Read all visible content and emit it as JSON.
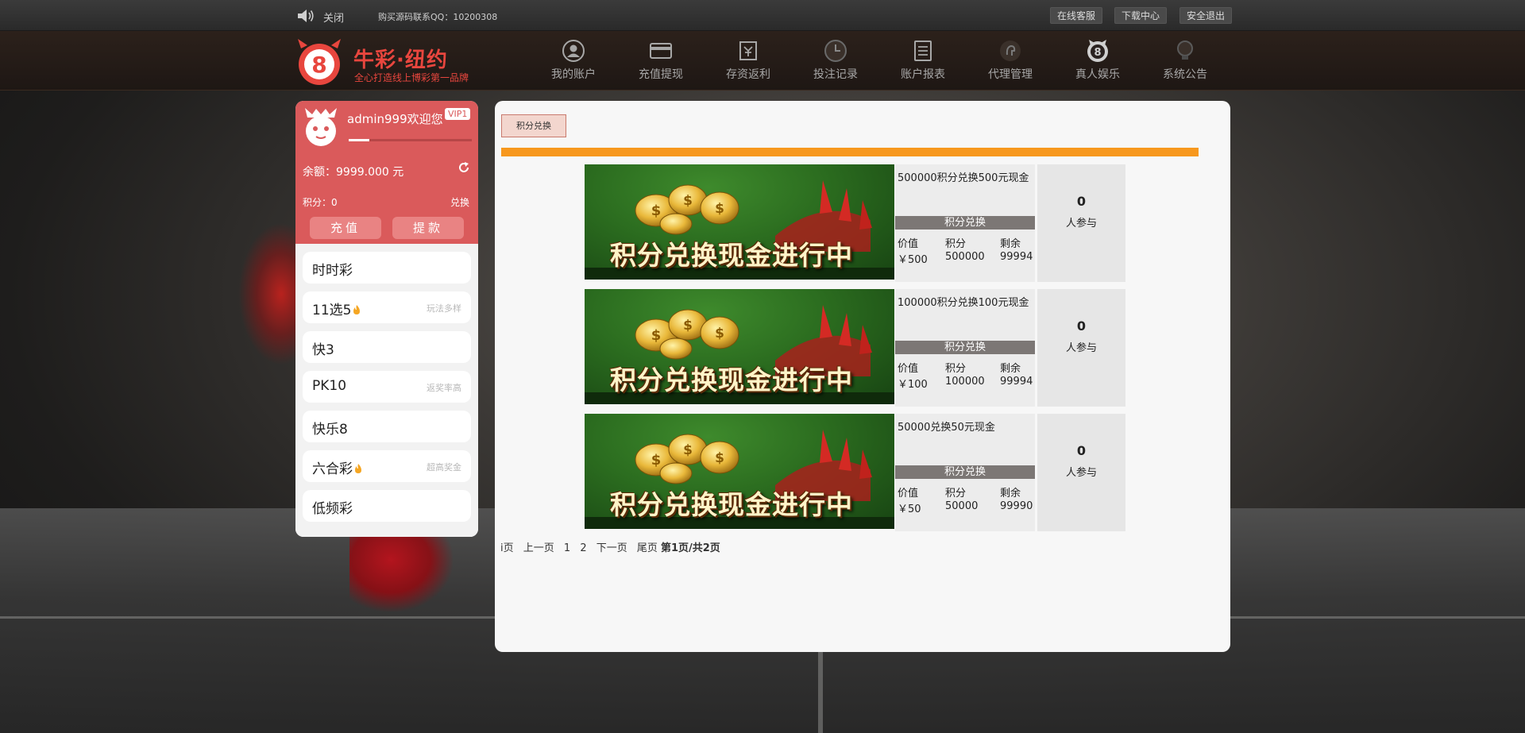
{
  "topbar": {
    "close_label": "关闭",
    "qq_text": "购买源码联系QQ：10200308",
    "buttons": [
      "在线客服",
      "下载中心",
      "安全退出"
    ]
  },
  "header": {
    "logo_title": "牛彩·纽约",
    "logo_sub": "全心打造线上博彩第一品牌",
    "nav": [
      {
        "label": "我的账户",
        "icon": "user-icon"
      },
      {
        "label": "充值提现",
        "icon": "card-icon"
      },
      {
        "label": "存资返利",
        "icon": "rebate-icon"
      },
      {
        "label": "投注记录",
        "icon": "clock-icon"
      },
      {
        "label": "账户报表",
        "icon": "report-icon"
      },
      {
        "label": "代理管理",
        "icon": "agent-icon"
      },
      {
        "label": "真人娱乐",
        "icon": "live-casino-icon"
      },
      {
        "label": "系统公告",
        "icon": "bulb-icon"
      }
    ]
  },
  "user": {
    "name": "admin999欢迎您",
    "vip": "VIP1",
    "progress": 0.17,
    "balance": "余额：9999.000 元",
    "points": "积分：0",
    "exchange": "兑换",
    "recharge": "充值",
    "withdraw": "提款"
  },
  "games": [
    {
      "name": "时时彩",
      "tag": "",
      "hot": false
    },
    {
      "name": "11选5",
      "tag": "玩法多样",
      "hot": true
    },
    {
      "name": "快3",
      "tag": "",
      "hot": false
    },
    {
      "name": "PK10",
      "tag": "返奖率高",
      "hot": false
    },
    {
      "name": "快乐8",
      "tag": "",
      "hot": false
    },
    {
      "name": "六合彩",
      "tag": "超高奖金",
      "hot": true
    },
    {
      "name": "低频彩",
      "tag": "",
      "hot": false
    }
  ],
  "main": {
    "tab": "积分兑换",
    "banner_text": "积分兑换现金进行中",
    "exchange_strip": "积分兑换",
    "labels": {
      "value": "价值",
      "points": "积分",
      "remaining": "剩余"
    },
    "participants_label": "人参与",
    "offers": [
      {
        "title": "500000积分兑换500元现金",
        "value": "￥500",
        "points": "500000",
        "remaining": "99994",
        "participants": "0"
      },
      {
        "title": "100000积分兑换100元现金",
        "value": "￥100",
        "points": "100000",
        "remaining": "99994",
        "participants": "0"
      },
      {
        "title": "50000兑换50元现金",
        "value": "￥50",
        "points": "50000",
        "remaining": "99990",
        "participants": "0"
      }
    ],
    "pager": {
      "first": "i页",
      "prev": "上一页",
      "page1": "1",
      "page2": "2",
      "next": "下一页",
      "last": "尾页",
      "status_prefix": "第",
      "current": "1",
      "status_mid": "页/共",
      "total": "2",
      "status_suffix": "页"
    }
  },
  "colors": {
    "accent_red": "#da5a5b",
    "orange_bar": "#f7981d",
    "logo_red": "#e8463e"
  }
}
